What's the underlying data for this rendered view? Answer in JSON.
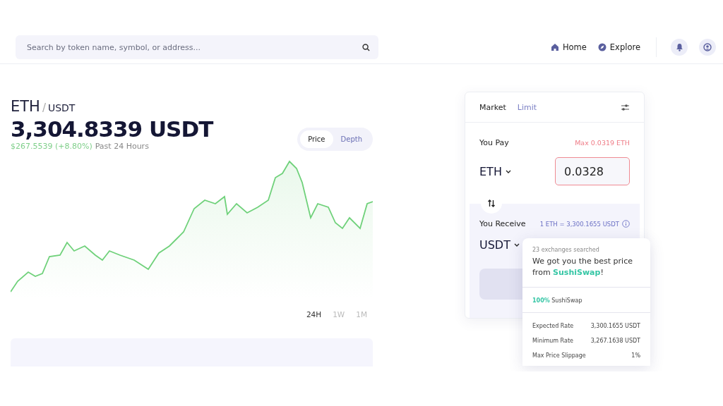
{
  "header": {
    "search": {
      "placeholder": "Search by token name, symbol, or address..."
    },
    "nav": [
      {
        "label": "Home",
        "kind": "home"
      },
      {
        "label": "Explore",
        "kind": "explore"
      }
    ]
  },
  "pair": {
    "base": "ETH",
    "separator": "/",
    "quote": "USDT",
    "price": "3,304.8339 USDT",
    "change": "$267.5539 (+8.80%)",
    "period": "Past 24 Hours"
  },
  "chart_tabs": [
    {
      "label": "Price",
      "selected": true
    },
    {
      "label": "Depth",
      "selected": false
    }
  ],
  "ranges": [
    {
      "label": "24H",
      "selected": true
    },
    {
      "label": "1W",
      "selected": false
    },
    {
      "label": "1M",
      "selected": false
    }
  ],
  "trade": {
    "tabs": [
      {
        "label": "Market",
        "selected": true
      },
      {
        "label": "Limit",
        "selected": false
      }
    ],
    "pay": {
      "label": "You Pay",
      "max": "Max 0.0319 ETH",
      "token": "ETH",
      "value": "0.0328",
      "error": true
    },
    "receive": {
      "label": "You Receive",
      "rate": "1 ETH = 3,300.1655 USDT",
      "token": "USDT"
    }
  },
  "popup": {
    "searched": "23 exchanges searched",
    "message_prefix": "We got you the best price from ",
    "exchange": "SushiSwap",
    "message_suffix": "!",
    "share": "100%",
    "share_exchange": "SushiSwap",
    "rows": [
      {
        "label": "Expected Rate",
        "value": "3,300.1655 USDT"
      },
      {
        "label": "Minimum Rate",
        "value": "3,267.1638 USDT"
      },
      {
        "label": "Max Price Slippage",
        "value": "1%"
      }
    ]
  }
}
